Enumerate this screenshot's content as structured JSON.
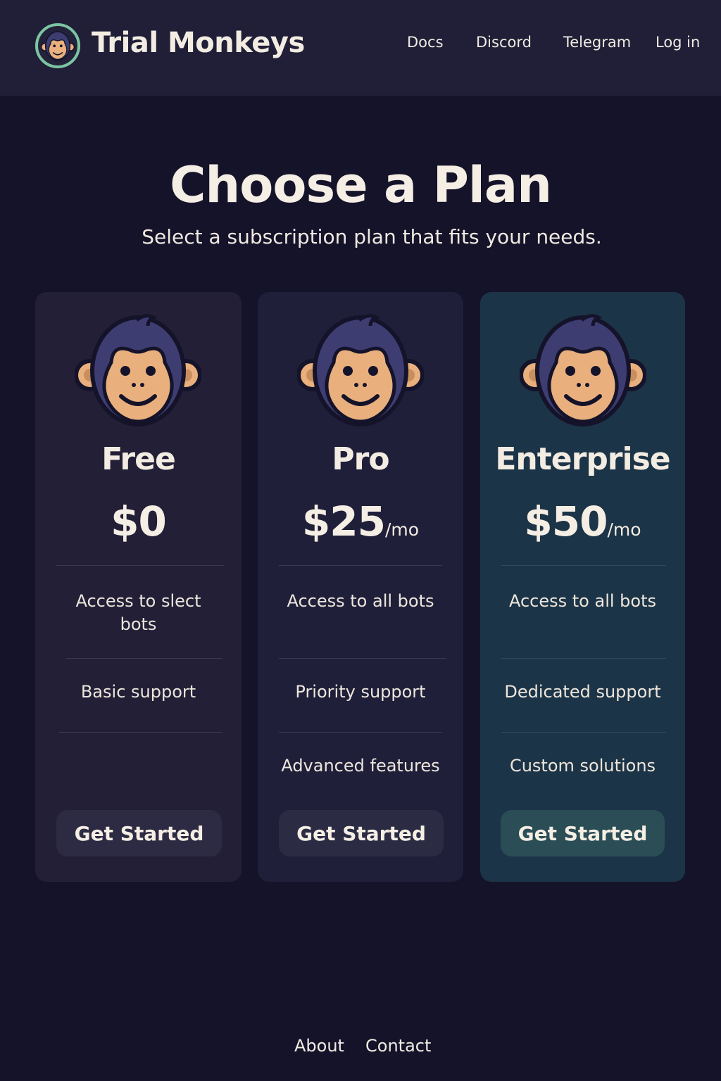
{
  "header": {
    "brand": "Trial Monkeys",
    "nav": [
      "Docs",
      "Discord",
      "Telegram",
      "Log in"
    ]
  },
  "hero": {
    "title": "Choose a Plan",
    "subtitle": "Select a subscription plan that fits your needs."
  },
  "plans": [
    {
      "name": "Free",
      "price": "$0",
      "period": "",
      "features": [
        "Access to slect bots",
        "Basic support"
      ],
      "cta": "Get Started"
    },
    {
      "name": "Pro",
      "price": "$25",
      "period": "/mo",
      "features": [
        "Access to all bots",
        "Priority support",
        "Advanced features"
      ],
      "cta": "Get Started"
    },
    {
      "name": "Enterprise",
      "price": "$50",
      "period": "/mo",
      "features": [
        "Access to all bots",
        "Dedicated support",
        "Custom solutions"
      ],
      "cta": "Get Started"
    }
  ],
  "footer": {
    "links": [
      "About",
      "Contact"
    ]
  },
  "colors": {
    "background": "#15132a",
    "header": "#201f37",
    "card": "#221f37",
    "card_highlight": "#1c3447",
    "logo_ring": "#7cc4a2",
    "monkey_fur": "#3e3d72",
    "monkey_face": "#e9b07d"
  },
  "icons": {
    "logo": "monkey-icon",
    "plan_icon": "monkey-icon"
  }
}
